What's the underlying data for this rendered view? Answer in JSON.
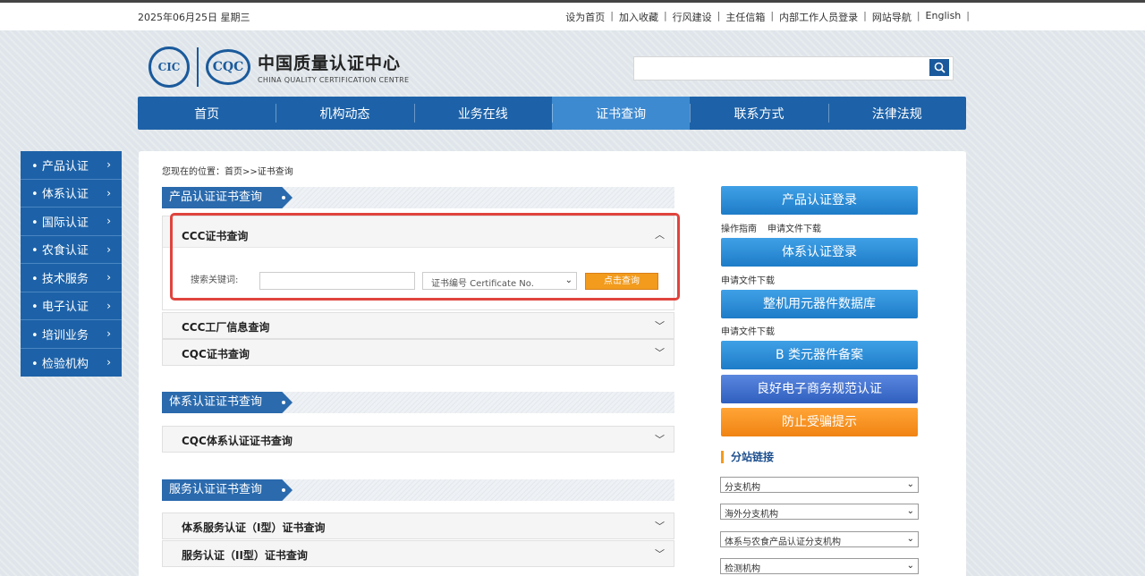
{
  "topbar": {
    "date": "2025年06月25日  星期三",
    "links": [
      "设为首页",
      "加入收藏",
      "行风建设",
      "主任信箱",
      "内部工作人员登录",
      "网站导航",
      "English"
    ]
  },
  "logo": {
    "cic": "CIC",
    "cqc": "CQC",
    "cn_name": "中国质量认证中心",
    "en_name": "CHINA QUALITY CERTIFICATION CENTRE"
  },
  "search": {
    "value": "",
    "placeholder": ""
  },
  "nav": [
    "首页",
    "机构动态",
    "业务在线",
    "证书查询",
    "联系方式",
    "法律法规"
  ],
  "nav_active": "证书查询",
  "sidebar": [
    "产品认证",
    "体系认证",
    "国际认证",
    "农食认证",
    "技术服务",
    "电子认证",
    "培训业务",
    "检验机构"
  ],
  "breadcrumb": "您现在的位置：首页>>证书查询",
  "sections": {
    "product": {
      "title": "产品认证证书查询",
      "open_item": {
        "label": "CCC证书查询",
        "keyword_label": "搜索关键词:",
        "select_value": "证书编号 Certificate No.",
        "query_button": "点击查询"
      },
      "items": [
        "CCC工厂信息查询",
        "CQC证书查询"
      ]
    },
    "system": {
      "title": "体系认证证书查询",
      "items": [
        "CQC体系认证证书查询"
      ]
    },
    "service": {
      "title": "服务认证证书查询",
      "items": [
        "体系服务认证（I型）证书查询",
        "服务认证（II型）证书查询"
      ]
    }
  },
  "right": {
    "product_login": "产品认证登录",
    "product_links": [
      "操作指南",
      "申请文件下载"
    ],
    "system_login": "体系认证登录",
    "system_links": [
      "申请文件下载"
    ],
    "components_db": "整机用元器件数据库",
    "components_links": [
      "申请文件下载"
    ],
    "b_class": "B 类元器件备案",
    "ecommerce": "良好电子商务规范认证",
    "fraud": "防止受骗提示",
    "branch_title": "分站链接",
    "dropdowns": [
      "分支机构",
      "海外分支机构",
      "体系与农食产品认证分支机构",
      "检测机构"
    ]
  },
  "colors": {
    "nav_blue": "#1d62a8",
    "nav_active": "#3d8ad0",
    "query_orange": "#f29b1d",
    "highlight_red": "#e0443d"
  }
}
